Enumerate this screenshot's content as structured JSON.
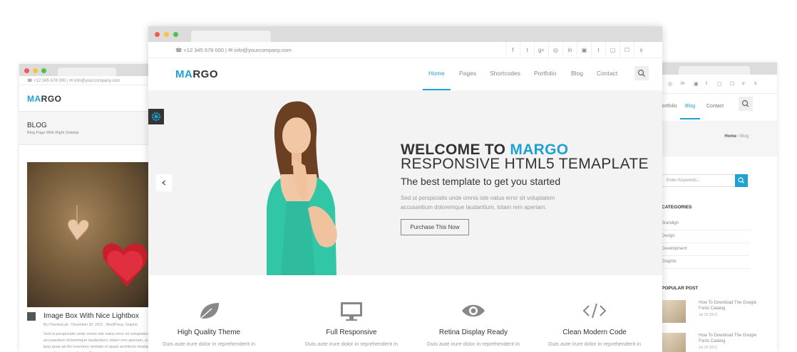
{
  "colors": {
    "accent": "#1ea1d3",
    "hero_bg": "#f3f3f3",
    "chrome": "#dcdcdc"
  },
  "left_window": {
    "contact": "☎ +12 345 678 000  |  ✉ info@yourcompany.com",
    "logo_a": "MA",
    "logo_b": "RGO",
    "banner_title": "BLOG",
    "banner_subtitle": "Blog Page With Right Sidebar",
    "post_title": "Image Box With Nice Lightbox",
    "post_meta": "By iThemesLab  ·  December 30, 2013  ·  WordPress, Graphic",
    "post_excerpt": "Sed ut perspiciatis unde omnis iste natus error sit voluptatem accusantium doloremque laudantium, totam rem aperiam, eaque ipsa quae ab illo inventore veritatis et quasi architecto beatae vitae dicta sunt explicabo. Nemo enim ipsam voluptatem quia voluptas sit aspernatur aut odit aut fugit"
  },
  "main_window": {
    "contact": "☎ +12 345 678 000  |  ✉ info@yourcompany.com",
    "social_icons": [
      "f",
      "t",
      "g+",
      "◎",
      "in",
      "▣",
      "t",
      "▢",
      "☐",
      "s"
    ],
    "logo_a": "MA",
    "logo_b": "RGO",
    "nav": [
      "Home",
      "Pages",
      "Shortcodes",
      "Portfolio",
      "Blog",
      "Contact"
    ],
    "active_nav": "Home",
    "hero": {
      "title_prefix": "WELCOME TO ",
      "title_accent": "MARGO",
      "title_line2": "RESPONSIVE HTML5 TEMAPLATE",
      "subtitle": "The best template to get you started",
      "text": "Sed ut perspiciatis unde omnis iste natus error sit voluptatem accusantium doloremque laudantium, totam rem aperiam.",
      "button": "Purchase This Now"
    },
    "features": [
      {
        "icon": "leaf-icon",
        "title": "High Quality Theme",
        "desc": "Duis aute irure dolor in reprehenderit in"
      },
      {
        "icon": "monitor-icon",
        "title": "Full Responsive",
        "desc": "Duis aute irure dolor in reprehenderit in"
      },
      {
        "icon": "eye-icon",
        "title": "Retina Display Ready",
        "desc": "Duis aute irure dolor in reprehenderit in"
      },
      {
        "icon": "code-icon",
        "title": "Clean Modern Code",
        "desc": "Duis aute irure dolor in reprehenderit in"
      }
    ]
  },
  "right_window": {
    "social_icons": [
      "◎",
      "in",
      "▣",
      "t",
      "▢",
      "☐",
      "v",
      "s"
    ],
    "nav": [
      "Portfolio",
      "Blog",
      "Contact"
    ],
    "active_nav": "Blog",
    "breadcrumb_home": "Home",
    "breadcrumb_sep": " / Blog",
    "search_placeholder": "Enter Keywords...",
    "categories_title": "CATEGORIES",
    "categories": [
      "Brandign",
      "Design",
      "Development",
      "Graphic"
    ],
    "popular_title": "POPULAR POST",
    "popular": [
      {
        "title": "How To Download The Google Fonts Catalog",
        "date": "Jul 29 2013"
      },
      {
        "title": "How To Download The Google Fonts Catalog",
        "date": "Jul 29 2013"
      }
    ]
  }
}
